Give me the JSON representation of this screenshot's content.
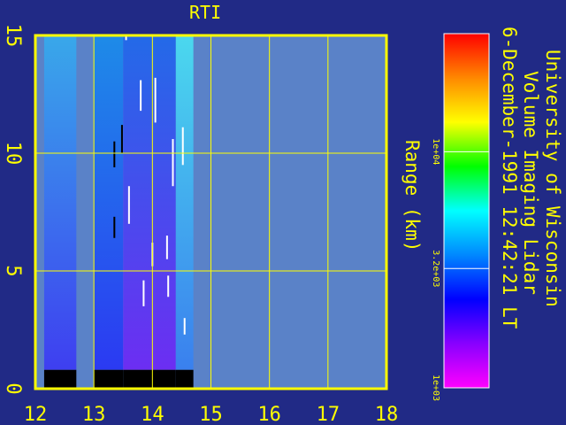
{
  "chart_data": {
    "type": "heatmap",
    "title": "RTI",
    "xlabel": "",
    "ylabel": "Range (km)",
    "xlim": [
      12,
      18
    ],
    "ylim": [
      0,
      15
    ],
    "x_ticks": [
      "12",
      "13",
      "14",
      "15",
      "16",
      "17",
      "18"
    ],
    "y_ticks": [
      "0",
      "5",
      "10",
      "15"
    ],
    "grid": true,
    "colorbar": {
      "labels": [
        "1e+04",
        "3.2e+03",
        "1e+03"
      ],
      "scale": "log",
      "range": [
        1000,
        31623
      ],
      "colors": [
        "#ff0000",
        "#ff8800",
        "#ffff00",
        "#00ff00",
        "#00ffff",
        "#0088ff",
        "#0000ff",
        "#8800ff",
        "#ff00ff"
      ]
    },
    "annotation_lines": [
      "University of Wisconsin",
      "Volume Imaging Lidar",
      "6-December-1991 12:42:21 LT"
    ],
    "data_columns": [
      {
        "x_start": 12.15,
        "x_end": 12.7,
        "surface_km": 0.8,
        "top_color": "#39a8ea",
        "bottom_color": "#3e3ff0"
      },
      {
        "x_start": 13.0,
        "x_end": 13.5,
        "surface_km": 0.8,
        "top_color": "#1e8be8",
        "bottom_color": "#2b3af2"
      },
      {
        "x_start": 13.5,
        "x_end": 14.4,
        "surface_km": 0.8,
        "top_color": "#236ae8",
        "bottom_color": "#6c2ef2"
      },
      {
        "x_start": 14.4,
        "x_end": 14.7,
        "surface_km": 0.8,
        "top_color": "#4bd8ee",
        "bottom_color": "#3a80ee"
      }
    ],
    "no_data_color": "#5a82c8"
  }
}
